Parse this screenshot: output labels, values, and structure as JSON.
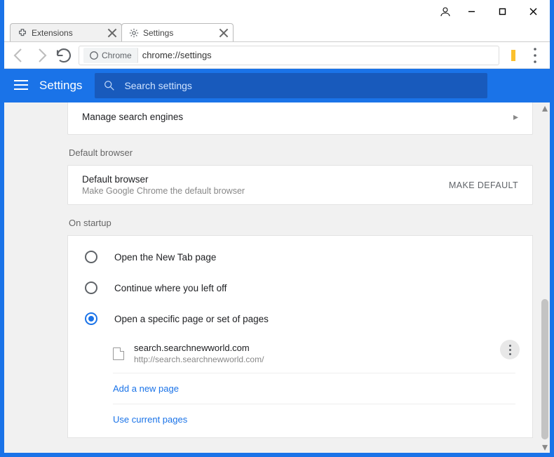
{
  "tabs": [
    {
      "label": "Extensions"
    },
    {
      "label": "Settings"
    }
  ],
  "omnibox": {
    "chip": "Chrome",
    "url": "chrome://settings"
  },
  "settingsbar": {
    "title": "Settings",
    "search_placeholder": "Search settings"
  },
  "manage_row": {
    "label": "Manage search engines"
  },
  "default_section": {
    "heading": "Default browser"
  },
  "default_browser": {
    "title": "Default browser",
    "sub": "Make Google Chrome the default browser",
    "button": "MAKE DEFAULT"
  },
  "startup_section": {
    "heading": "On startup"
  },
  "startup": {
    "opt1": "Open the New Tab page",
    "opt2": "Continue where you left off",
    "opt3": "Open a specific page or set of pages",
    "page_title": "search.searchnewworld.com",
    "page_url": "http://search.searchnewworld.com/",
    "add_link": "Add a new page",
    "use_link": "Use current pages"
  }
}
